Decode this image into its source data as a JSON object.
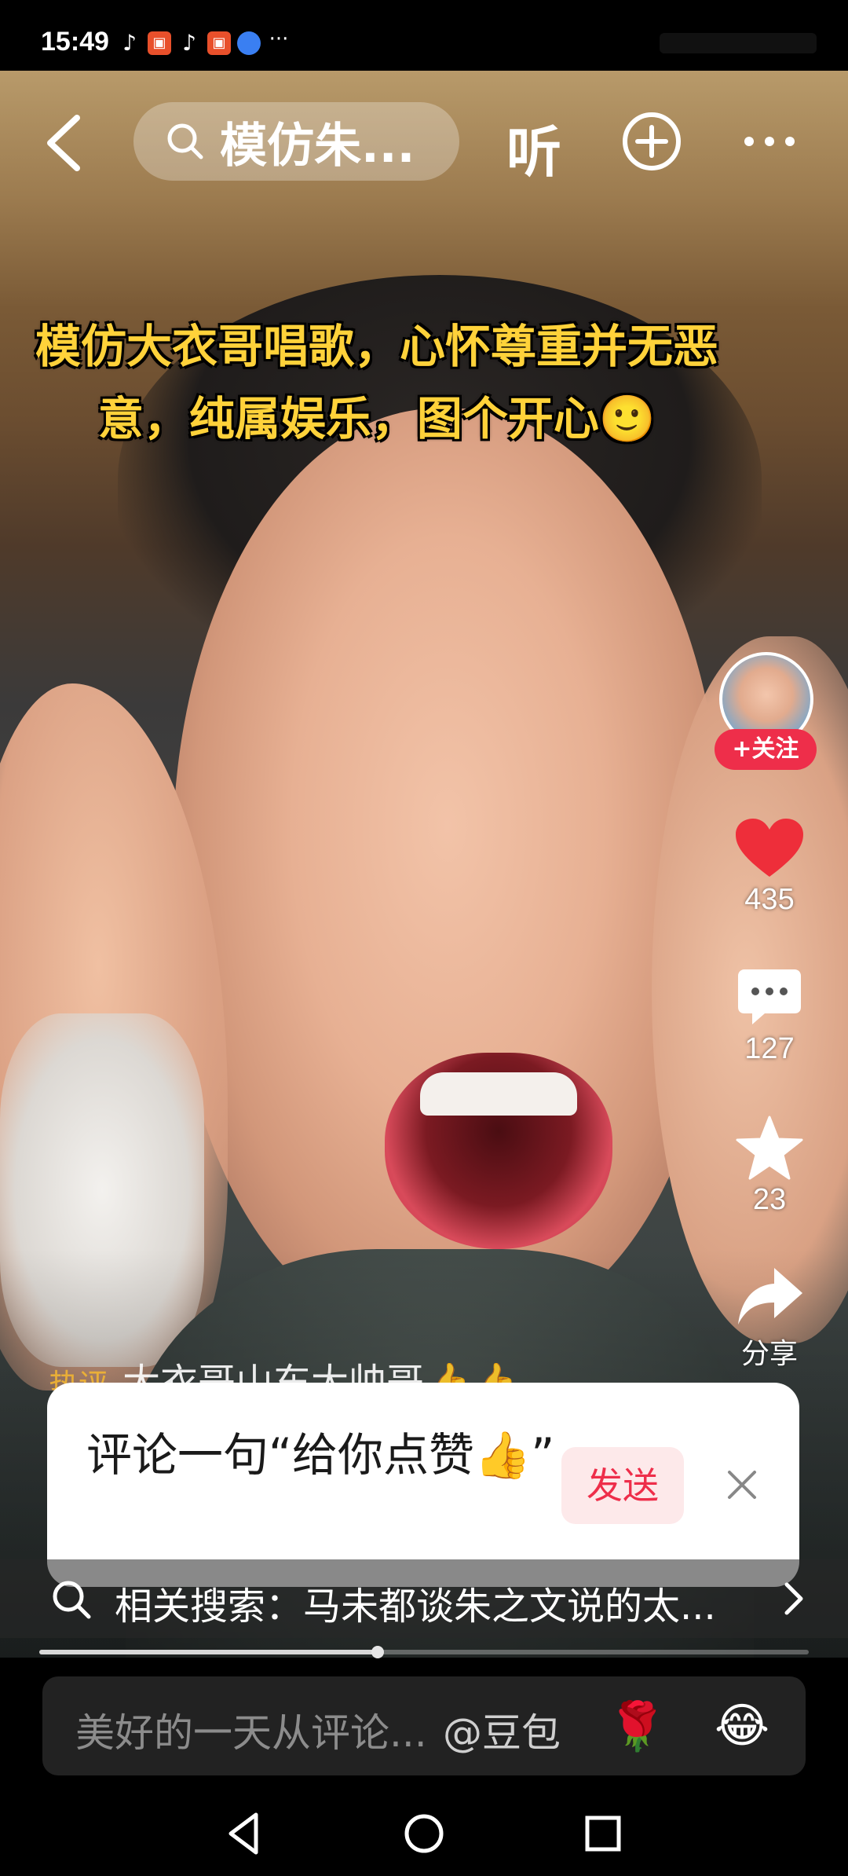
{
  "status_bar": {
    "time": "15:49",
    "notification_more": "···"
  },
  "top_nav": {
    "search_text": "模仿朱...",
    "listen_label": "听"
  },
  "video": {
    "caption": "模仿大衣哥唱歌，心怀尊重并无恶意，纯属娱乐，图个开心🙂"
  },
  "author": {
    "follow_label": "+关注"
  },
  "actions": {
    "likes": "435",
    "comments": "127",
    "favorites": "23",
    "share_label": "分享"
  },
  "hot_comment": {
    "tag": "热评",
    "text": "大衣哥山东大帅哥👍👍"
  },
  "comment_popup": {
    "prompt": "评论一句“给你点赞👍”",
    "send_label": "发送"
  },
  "related_search": {
    "text": "相关搜索：马未都谈朱之文说的太..."
  },
  "playback": {
    "progress": 0.44
  },
  "comment_bar": {
    "placeholder": "美好的一天从评论...",
    "mention": "@豆包",
    "emoji_1": "🌹",
    "emoji_2": "😂"
  },
  "colors": {
    "accent_red": "#ee2e4a",
    "caption_yellow": "#ffd23a"
  }
}
